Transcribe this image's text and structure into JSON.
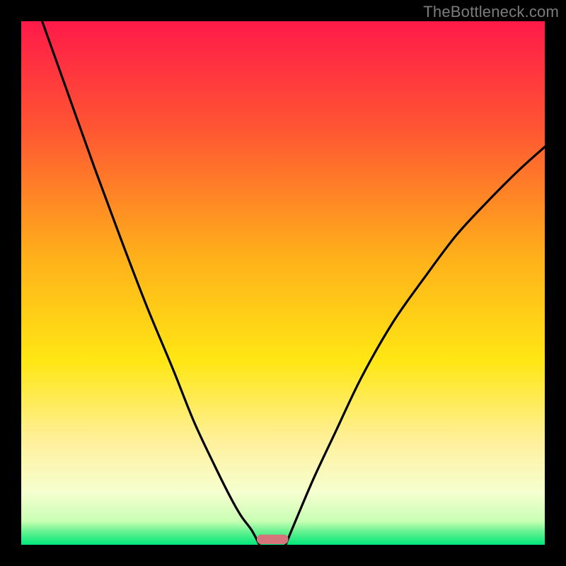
{
  "attribution": "TheBottleneck.com",
  "chart_data": {
    "type": "line",
    "title": "",
    "xlabel": "",
    "ylabel": "",
    "xlim": [
      0,
      1
    ],
    "ylim": [
      0,
      1
    ],
    "gradient_stops": [
      {
        "pos": 0.0,
        "color": "#ff1a49"
      },
      {
        "pos": 0.2,
        "color": "#ff5433"
      },
      {
        "pos": 0.45,
        "color": "#ffb01a"
      },
      {
        "pos": 0.65,
        "color": "#ffe714"
      },
      {
        "pos": 0.8,
        "color": "#fff09a"
      },
      {
        "pos": 0.9,
        "color": "#f6ffd0"
      },
      {
        "pos": 0.955,
        "color": "#c8ffb4"
      },
      {
        "pos": 0.975,
        "color": "#66f291"
      },
      {
        "pos": 1.0,
        "color": "#00e77a"
      }
    ],
    "series": [
      {
        "name": "left-curve",
        "x": [
          0.04,
          0.09,
          0.14,
          0.19,
          0.24,
          0.29,
          0.33,
          0.37,
          0.4,
          0.42,
          0.44,
          0.455
        ],
        "y": [
          1.0,
          0.86,
          0.72,
          0.585,
          0.455,
          0.335,
          0.235,
          0.15,
          0.09,
          0.055,
          0.028,
          0.0
        ]
      },
      {
        "name": "right-curve",
        "x": [
          0.505,
          0.53,
          0.56,
          0.6,
          0.65,
          0.71,
          0.77,
          0.83,
          0.89,
          0.95,
          1.0
        ],
        "y": [
          0.0,
          0.06,
          0.13,
          0.215,
          0.32,
          0.425,
          0.51,
          0.59,
          0.655,
          0.715,
          0.76
        ]
      }
    ],
    "marker": {
      "x_center": 0.48,
      "width": 0.06,
      "height": 0.018,
      "color": "#d6747c"
    }
  }
}
